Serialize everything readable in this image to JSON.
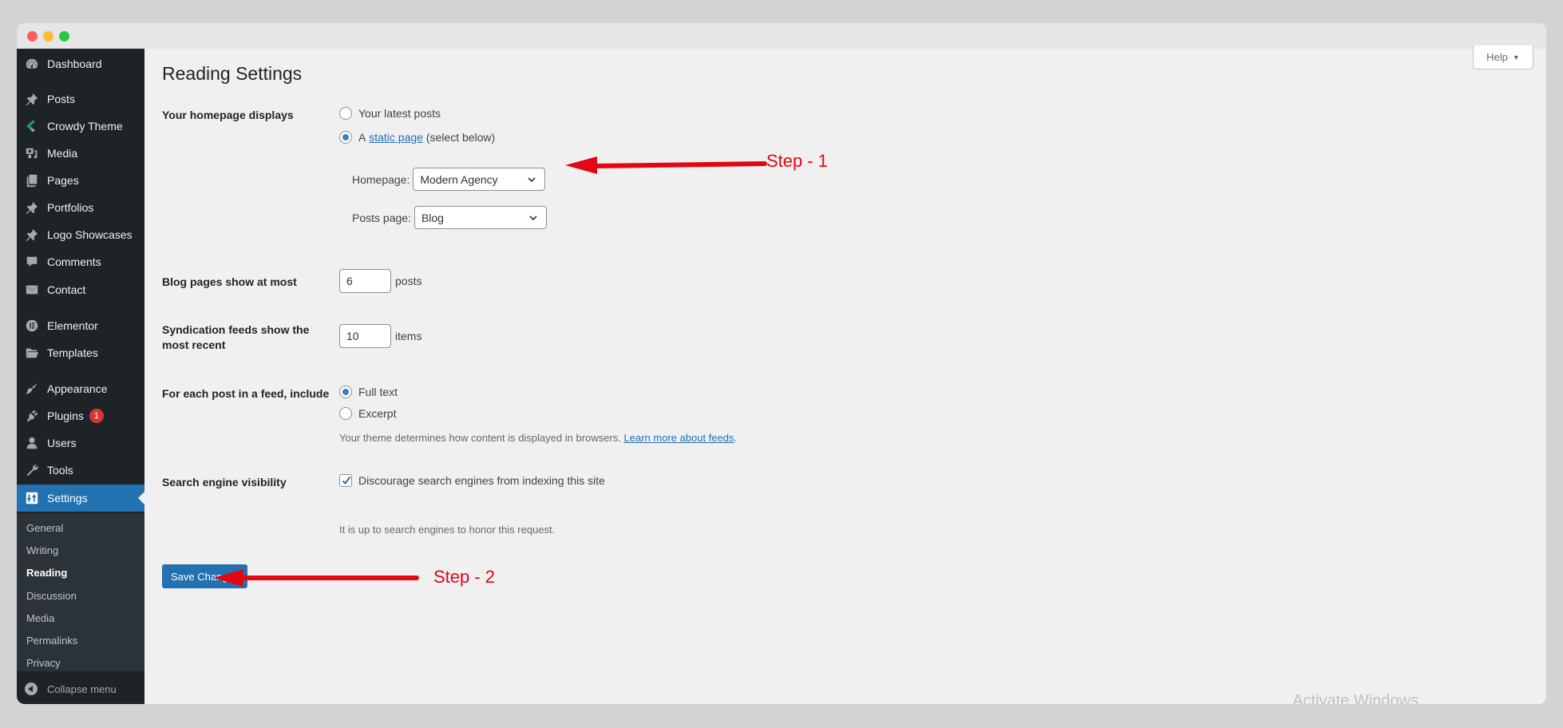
{
  "window": {
    "traffic_lights": [
      "close",
      "minimize",
      "maximize"
    ]
  },
  "sidebar": {
    "items": [
      {
        "label": "Dashboard",
        "icon": "dashboard-icon"
      },
      {
        "label": "Posts",
        "icon": "pin-icon"
      },
      {
        "label": "Crowdy Theme",
        "icon": "crowdy-theme-icon"
      },
      {
        "label": "Media",
        "icon": "media-icon"
      },
      {
        "label": "Pages",
        "icon": "pages-icon"
      },
      {
        "label": "Portfolios",
        "icon": "pin-icon"
      },
      {
        "label": "Logo Showcases",
        "icon": "pin-icon"
      },
      {
        "label": "Comments",
        "icon": "comment-icon"
      },
      {
        "label": "Contact",
        "icon": "mail-icon"
      },
      {
        "label": "Elementor",
        "icon": "elementor-icon"
      },
      {
        "label": "Templates",
        "icon": "folder-icon"
      },
      {
        "label": "Appearance",
        "icon": "paintbrush-icon"
      },
      {
        "label": "Plugins",
        "icon": "plugin-icon",
        "badge": "1"
      },
      {
        "label": "Users",
        "icon": "user-icon"
      },
      {
        "label": "Tools",
        "icon": "wrench-icon"
      },
      {
        "label": "Settings",
        "icon": "settings-icon",
        "active": true
      }
    ],
    "submenu": [
      {
        "label": "General"
      },
      {
        "label": "Writing"
      },
      {
        "label": "Reading",
        "current": true
      },
      {
        "label": "Discussion"
      },
      {
        "label": "Media"
      },
      {
        "label": "Permalinks"
      },
      {
        "label": "Privacy"
      }
    ],
    "collapse_label": "Collapse menu"
  },
  "header": {
    "help_label": "Help",
    "title": "Reading Settings"
  },
  "form": {
    "homepage_displays": {
      "label": "Your homepage displays",
      "option_latest": "Your latest posts",
      "option_static_prefix": "A",
      "option_static_link": "static page",
      "option_static_suffix": "(select below)",
      "selected": "static",
      "homepage_label": "Homepage:",
      "homepage_value": "Modern Agency",
      "posts_page_label": "Posts page:",
      "posts_page_value": "Blog"
    },
    "blog_pages": {
      "label": "Blog pages show at most",
      "value": "6",
      "unit": "posts"
    },
    "syndication": {
      "label": "Syndication feeds show the most recent",
      "value": "10",
      "unit": "items"
    },
    "feed_include": {
      "label": "For each post in a feed, include",
      "option_full": "Full text",
      "option_excerpt": "Excerpt",
      "selected": "full",
      "description": "Your theme determines how content is displayed in browsers.",
      "link": "Learn more about feeds",
      "link_suffix": "."
    },
    "search_visibility": {
      "label": "Search engine visibility",
      "checkbox_label": "Discourage search engines from indexing this site",
      "checked": true,
      "description": "It is up to search engines to honor this request."
    },
    "save_label": "Save Changes"
  },
  "annotations": {
    "step1": "Step - 1",
    "step2": "Step - 2",
    "color": "#e30613"
  },
  "watermark": "Activate Windows",
  "colors": {
    "sidebar_bg": "#1d2327",
    "accent": "#2271b1",
    "badge": "#d63638"
  }
}
